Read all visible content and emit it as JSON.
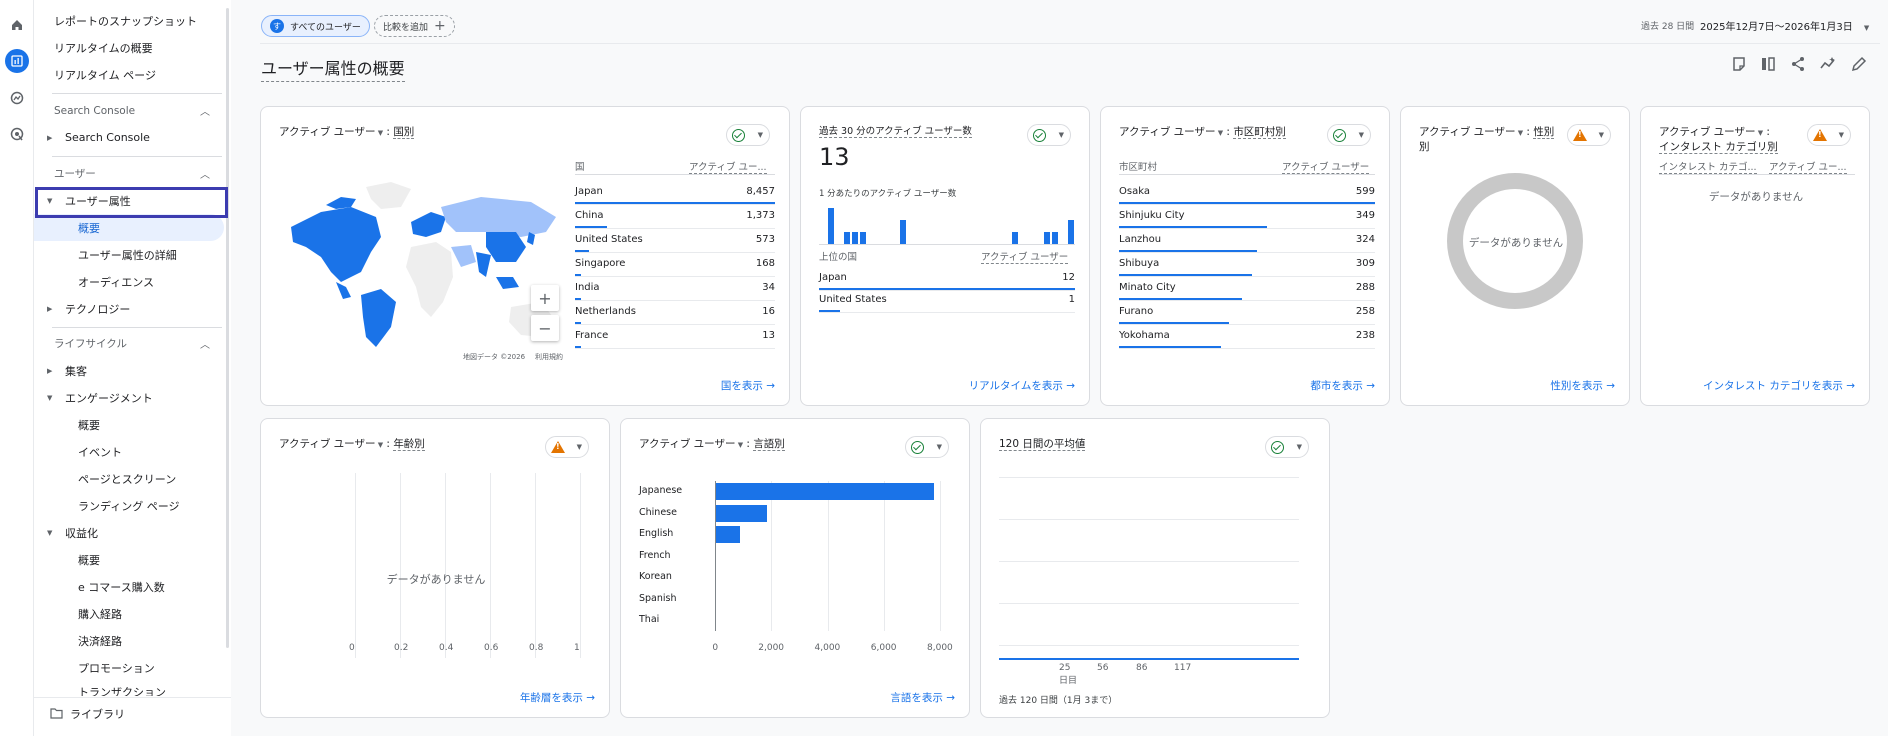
{
  "rail": {
    "items": [
      "home-icon",
      "reports-icon",
      "explore-icon",
      "advertising-icon"
    ]
  },
  "sidebar": {
    "snapshot": "レポートのスナップショット",
    "realtime_overview": "リアルタイムの概要",
    "realtime_pages": "リアルタイム ページ",
    "search_console_head": "Search Console",
    "search_console": "Search Console",
    "user_head": "ユーザー",
    "user_attributes": "ユーザー属性",
    "overview": "概要",
    "user_attr_detail": "ユーザー属性の詳細",
    "audience": "オーディエンス",
    "technology": "テクノロジー",
    "lifecycle_head": "ライフサイクル",
    "acquisition": "集客",
    "engagement": "エンゲージメント",
    "eng_overview": "概要",
    "events": "イベント",
    "pages_screens": "ページとスクリーン",
    "landing_page": "ランディング ページ",
    "monetization": "収益化",
    "mon_overview": "概要",
    "ecommerce": "e コマース購入数",
    "purchase_journey": "購入経路",
    "checkout_journey": "決済経路",
    "promotion": "プロモーション",
    "transactions": "トランザクション",
    "library": "ライブラリ"
  },
  "topbar": {
    "segment_badge": "す",
    "segment": "すべてのユーザー",
    "add_compare": "比較を追加",
    "date_prefix": "過去 28 日間",
    "date_range": "2025年12月7日～2026年1月3日"
  },
  "page": {
    "title": "ユーザー属性の概要"
  },
  "cards": {
    "country": {
      "title_a": "アクティブ ユーザー",
      "title_b": "国別",
      "col_country": "国",
      "col_users": "アクティブ ユー...",
      "rows": [
        {
          "k": "Japan",
          "v": "8,457",
          "f": 1.0
        },
        {
          "k": "China",
          "v": "1,373",
          "f": 0.162
        },
        {
          "k": "United States",
          "v": "573",
          "f": 0.068
        },
        {
          "k": "Singapore",
          "v": "168",
          "f": 0.02
        },
        {
          "k": "India",
          "v": "34",
          "f": 0.004
        },
        {
          "k": "Netherlands",
          "v": "16",
          "f": 0.002
        },
        {
          "k": "France",
          "v": "13",
          "f": 0.0015
        }
      ],
      "map_credit": "地図データ ©2026",
      "map_terms": "利用規約",
      "zoom_in": "+",
      "zoom_out": "−",
      "link": "国を表示"
    },
    "realtime": {
      "title": "過去 30 分のアクティブ ユーザー数",
      "value": "13",
      "sub": "1 分あたりのアクティブ ユーザー数",
      "col_country": "上位の国",
      "col_users": "アクティブ ユーザー",
      "spark": [
        0,
        3,
        0,
        1,
        1,
        1,
        0,
        0,
        0,
        0,
        2,
        0,
        0,
        0,
        0,
        0,
        0,
        0,
        0,
        0,
        0,
        0,
        0,
        0,
        1,
        0,
        0,
        0,
        1,
        1,
        0,
        2
      ],
      "rows": [
        {
          "k": "Japan",
          "v": "12",
          "f": 1.0
        },
        {
          "k": "United States",
          "v": "1",
          "f": 0.083
        }
      ],
      "link": "リアルタイムを表示"
    },
    "city": {
      "title_a": "アクティブ ユーザー",
      "title_b": "市区町村別",
      "col_city": "市区町村",
      "col_users": "アクティブ ユーザー",
      "rows": [
        {
          "k": "Osaka",
          "v": "599",
          "f": 1.0
        },
        {
          "k": "Shinjuku City",
          "v": "349",
          "f": 0.58
        },
        {
          "k": "Lanzhou",
          "v": "324",
          "f": 0.54
        },
        {
          "k": "Shibuya",
          "v": "309",
          "f": 0.52
        },
        {
          "k": "Minato City",
          "v": "288",
          "f": 0.48
        },
        {
          "k": "Furano",
          "v": "258",
          "f": 0.43
        },
        {
          "k": "Yokohama",
          "v": "238",
          "f": 0.4
        }
      ],
      "link": "都市を表示"
    },
    "gender": {
      "title_a": "アクティブ ユーザー",
      "title_b": "性別",
      "title_c": "別",
      "nodata": "データがありません",
      "link": "性別を表示"
    },
    "interest": {
      "title_a": "アクティブ ユーザー",
      "title_b": "インタレスト カテゴリ別",
      "col_cat": "インタレスト カテゴ...",
      "col_users": "アクティブ ユー...",
      "nodata": "データがありません",
      "link": "インタレスト カテゴリを表示"
    },
    "age": {
      "title_a": "アクティブ ユーザー",
      "title_b": "年齢別",
      "nodata": "データがありません",
      "ticks": [
        "0",
        "0.2",
        "0.4",
        "0.6",
        "0.8",
        "1"
      ],
      "link": "年齢層を表示"
    },
    "language": {
      "title_a": "アクティブ ユーザー",
      "title_b": "言語別",
      "link": "言語を表示"
    },
    "avg120": {
      "title": "120 日間の平均値",
      "ticks": [
        "25",
        "56",
        "86",
        "117"
      ],
      "xunit": "日目",
      "caption": "過去 120 日間（1月 3まで）"
    }
  },
  "chart_data": {
    "type": "bar",
    "title": "アクティブ ユーザー: 言語別",
    "categories": [
      "Japanese",
      "Chinese",
      "English",
      "French",
      "Korean",
      "Spanish",
      "Thai"
    ],
    "values": [
      7780,
      1850,
      880,
      40,
      25,
      20,
      15
    ],
    "xlim": [
      0,
      8000
    ],
    "xticks": [
      "0",
      "2,000",
      "4,000",
      "6,000",
      "8,000"
    ],
    "orientation": "horizontal",
    "grid": true
  }
}
